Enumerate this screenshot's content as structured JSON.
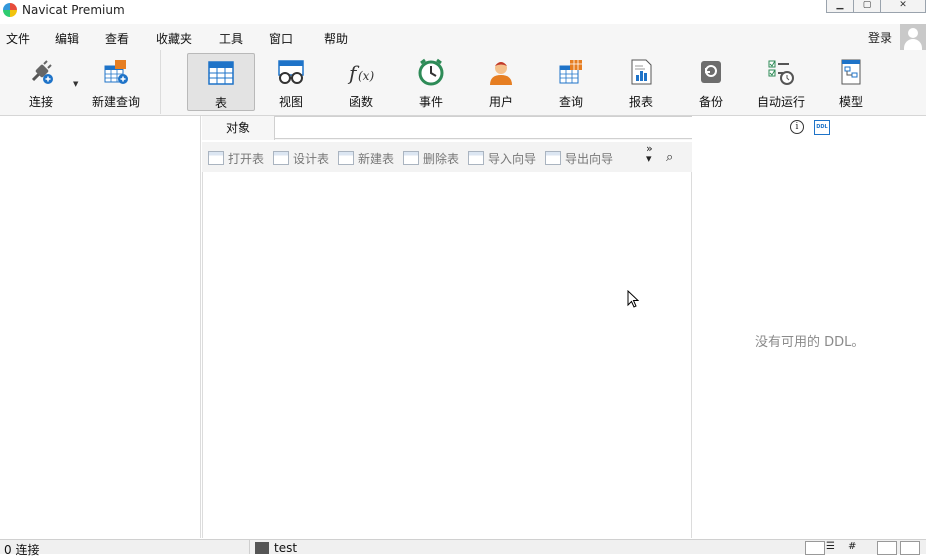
{
  "window": {
    "title": "Navicat Premium"
  },
  "menubar": {
    "items": [
      "文件",
      "编辑",
      "查看",
      "收藏夹",
      "工具",
      "窗口",
      "帮助"
    ],
    "login": "登录"
  },
  "toolbar": {
    "connect": "连接",
    "new_query": "新建查询",
    "buttons": [
      "表",
      "视图",
      "函数",
      "事件",
      "用户",
      "查询",
      "报表",
      "备份",
      "自动运行",
      "模型"
    ],
    "active": "表"
  },
  "objects_tab": {
    "label": "对象"
  },
  "object_toolbar": {
    "buttons": [
      "打开表",
      "设计表",
      "新建表",
      "删除表",
      "导入向导",
      "导出向导"
    ]
  },
  "ddl_panel": {
    "empty_text": "没有可用的 DDL。"
  },
  "statusbar": {
    "connections": "0 连接",
    "current": "test"
  },
  "colors": {
    "accent": "#1e73c8",
    "toolbar_bg": "#f6f6f6",
    "active_button": "#e3e3e3"
  }
}
